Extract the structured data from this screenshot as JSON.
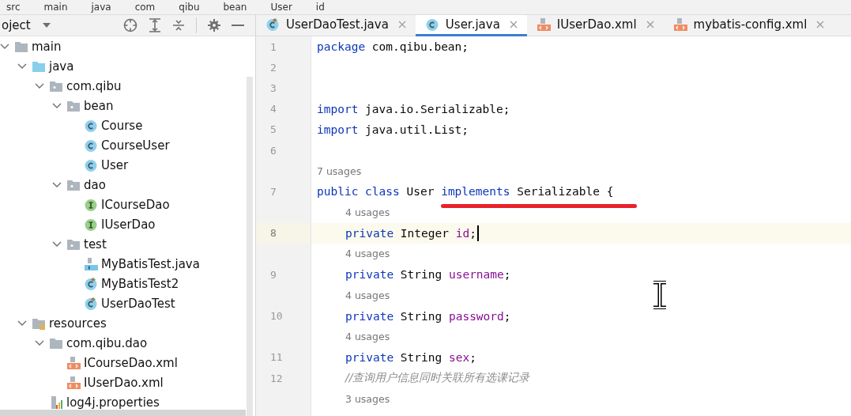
{
  "breadcrumb": [
    "src",
    "main",
    "java",
    "com",
    "qibu",
    "bean",
    "User",
    "id"
  ],
  "project_panel": {
    "title": "oject",
    "tree": [
      {
        "label": "main",
        "kind": "folder",
        "expanded": true,
        "children": [
          {
            "label": "java",
            "kind": "source-folder",
            "expanded": true,
            "children": [
              {
                "label": "com.qibu",
                "kind": "package",
                "expanded": true,
                "children": [
                  {
                    "label": "bean",
                    "kind": "package",
                    "expanded": true,
                    "children": [
                      {
                        "label": "Course",
                        "kind": "class"
                      },
                      {
                        "label": "CourseUser",
                        "kind": "class"
                      },
                      {
                        "label": "User",
                        "kind": "class"
                      }
                    ]
                  },
                  {
                    "label": "dao",
                    "kind": "package",
                    "expanded": true,
                    "children": [
                      {
                        "label": "ICourseDao",
                        "kind": "interface"
                      },
                      {
                        "label": "IUserDao",
                        "kind": "interface"
                      }
                    ]
                  },
                  {
                    "label": "test",
                    "kind": "package",
                    "expanded": true,
                    "children": [
                      {
                        "label": "MyBatisTest.java",
                        "kind": "java-file"
                      },
                      {
                        "label": "MyBatisTest2",
                        "kind": "test-class"
                      },
                      {
                        "label": "UserDaoTest",
                        "kind": "test-class"
                      }
                    ]
                  }
                ]
              }
            ]
          },
          {
            "label": "resources",
            "kind": "resources-folder",
            "expanded": true,
            "children": [
              {
                "label": "com.qibu.dao",
                "kind": "folder",
                "expanded": true,
                "children": [
                  {
                    "label": "ICourseDao.xml",
                    "kind": "xml"
                  },
                  {
                    "label": "IUserDao.xml",
                    "kind": "xml"
                  }
                ]
              },
              {
                "label": "log4j.properties",
                "kind": "properties"
              }
            ]
          }
        ]
      }
    ]
  },
  "tabs": [
    {
      "label": "UserDaoTest.java",
      "kind": "test-class",
      "selected": false
    },
    {
      "label": "User.java",
      "kind": "class",
      "selected": true
    },
    {
      "label": "IUserDao.xml",
      "kind": "xml",
      "selected": false
    },
    {
      "label": "mybatis-config.xml",
      "kind": "xml",
      "selected": false
    }
  ],
  "editor": {
    "lines": [
      {
        "kind": "code",
        "number": "1",
        "current": false,
        "tokens": [
          {
            "kind": "keyword",
            "text": "package"
          },
          {
            "kind": "plain",
            "text": " com.qibu.bean;"
          }
        ]
      },
      {
        "kind": "code",
        "number": "2",
        "current": false
      },
      {
        "kind": "code",
        "number": "3",
        "current": false
      },
      {
        "kind": "code",
        "number": "4",
        "current": false,
        "tokens": [
          {
            "kind": "keyword",
            "text": "import"
          },
          {
            "kind": "plain",
            "text": " java.io.Serializable;"
          }
        ]
      },
      {
        "kind": "code",
        "number": "5",
        "current": false,
        "tokens": [
          {
            "kind": "keyword",
            "text": "import"
          },
          {
            "kind": "plain",
            "text": " java.util.List;"
          }
        ]
      },
      {
        "kind": "code",
        "number": "6",
        "current": false
      },
      {
        "kind": "usages",
        "text": "7 usages"
      },
      {
        "kind": "code",
        "number": "7",
        "current": false,
        "tokens": [
          {
            "kind": "keyword",
            "text": "public class"
          },
          {
            "kind": "plain",
            "text": " User "
          },
          {
            "kind": "keyword",
            "text": "implements"
          },
          {
            "kind": "plain",
            "text": " Serializable {"
          }
        ],
        "children": [
          {
            "kind": "usages",
            "text": "4 usages"
          },
          {
            "kind": "code",
            "number": "8",
            "current": true,
            "tokens": [
              {
                "kind": "keyword",
                "text": "private"
              },
              {
                "kind": "plain",
                "text": " Integer "
              },
              {
                "kind": "field",
                "text": "id"
              },
              {
                "kind": "plain",
                "text": ";"
              }
            ]
          },
          {
            "kind": "usages",
            "text": "4 usages"
          },
          {
            "kind": "code",
            "number": "9",
            "current": false,
            "tokens": [
              {
                "kind": "keyword",
                "text": "private"
              },
              {
                "kind": "plain",
                "text": " String "
              },
              {
                "kind": "field",
                "text": "username"
              },
              {
                "kind": "plain",
                "text": ";"
              }
            ]
          },
          {
            "kind": "usages",
            "text": "4 usages"
          },
          {
            "kind": "code",
            "number": "10",
            "current": false,
            "tokens": [
              {
                "kind": "keyword",
                "text": "private"
              },
              {
                "kind": "plain",
                "text": " String "
              },
              {
                "kind": "field",
                "text": "password"
              },
              {
                "kind": "plain",
                "text": ";"
              }
            ]
          },
          {
            "kind": "usages",
            "text": "4 usages"
          },
          {
            "kind": "code",
            "number": "11",
            "current": false,
            "tokens": [
              {
                "kind": "keyword",
                "text": "private"
              },
              {
                "kind": "plain",
                "text": " String "
              },
              {
                "kind": "field",
                "text": "sex"
              },
              {
                "kind": "plain",
                "text": ";"
              }
            ]
          },
          {
            "kind": "code",
            "number": "12",
            "current": false,
            "tokens": [
              {
                "kind": "comment",
                "text": "//查询用户信息同时关联所有选课记录"
              }
            ]
          },
          {
            "kind": "usages",
            "text": "3 usages"
          }
        ]
      }
    ]
  }
}
